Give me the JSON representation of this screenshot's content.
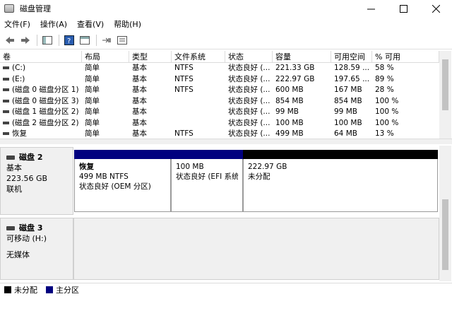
{
  "window": {
    "title": "磁盘管理"
  },
  "menu": [
    {
      "label": "文件(F)"
    },
    {
      "label": "操作(A)"
    },
    {
      "label": "查看(V)"
    },
    {
      "label": "帮助(H)"
    }
  ],
  "toolbar": [
    "back-icon",
    "forward-icon",
    "console-tree-icon",
    "help-icon",
    "properties-icon",
    "connect-icon",
    "settings-icon"
  ],
  "volume_table": {
    "columns": [
      "卷",
      "布局",
      "类型",
      "文件系统",
      "状态",
      "容量",
      "可用空间",
      "% 可用"
    ],
    "rows": [
      {
        "vol": "(C:)",
        "layout": "简单",
        "type": "基本",
        "fs": "NTFS",
        "status": "状态良好 (...",
        "cap": "221.33 GB",
        "free": "128.59 ...",
        "pct": "58 %"
      },
      {
        "vol": "(E:)",
        "layout": "简单",
        "type": "基本",
        "fs": "NTFS",
        "status": "状态良好 (...",
        "cap": "222.97 GB",
        "free": "197.65 ...",
        "pct": "89 %"
      },
      {
        "vol": "(磁盘 0 磁盘分区 1)",
        "layout": "简单",
        "type": "基本",
        "fs": "NTFS",
        "status": "状态良好 (...",
        "cap": "600 MB",
        "free": "167 MB",
        "pct": "28 %"
      },
      {
        "vol": "(磁盘 0 磁盘分区 3)",
        "layout": "简单",
        "type": "基本",
        "fs": "",
        "status": "状态良好 (...",
        "cap": "854 MB",
        "free": "854 MB",
        "pct": "100 %"
      },
      {
        "vol": "(磁盘 1 磁盘分区 2)",
        "layout": "简单",
        "type": "基本",
        "fs": "",
        "status": "状态良好 (...",
        "cap": "99 MB",
        "free": "99 MB",
        "pct": "100 %"
      },
      {
        "vol": "(磁盘 2 磁盘分区 2)",
        "layout": "简单",
        "type": "基本",
        "fs": "",
        "status": "状态良好 (...",
        "cap": "100 MB",
        "free": "100 MB",
        "pct": "100 %"
      },
      {
        "vol": "恢复",
        "layout": "简单",
        "type": "基本",
        "fs": "NTFS",
        "status": "状态良好 (...",
        "cap": "499 MB",
        "free": "64 MB",
        "pct": "13 %"
      }
    ]
  },
  "disks": {
    "disk2": {
      "name": "磁盘 2",
      "type": "基本",
      "size": "223.56 GB",
      "status": "联机",
      "partitions": [
        {
          "name": "恢复",
          "size": "499 MB NTFS",
          "status": "状态良好 (OEM 分区)",
          "color": "#00007f"
        },
        {
          "name": "",
          "size": "100 MB",
          "status": "状态良好 (EFI 系统",
          "color": "#00007f"
        },
        {
          "name": "",
          "size": "222.97 GB",
          "status": "未分配",
          "color": "#000000"
        }
      ]
    },
    "disk3": {
      "name": "磁盘 3",
      "type": "可移动 (H:)",
      "status": "无媒体"
    }
  },
  "legend": [
    {
      "label": "未分配",
      "color": "#000000"
    },
    {
      "label": "主分区",
      "color": "#00007f"
    }
  ]
}
